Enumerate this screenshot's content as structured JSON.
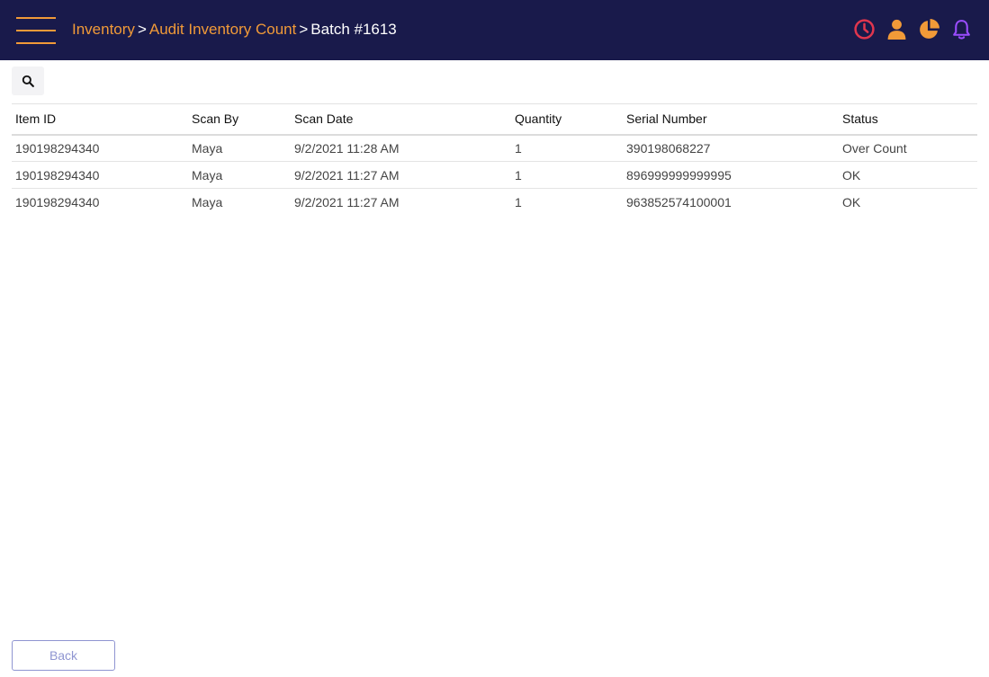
{
  "breadcrumb": {
    "items": [
      "Inventory",
      "Audit Inventory Count"
    ],
    "separator": ">",
    "current": "Batch #1613"
  },
  "icons": {
    "menu": "hamburger-menu-icon",
    "history": "clock-icon",
    "user": "user-icon",
    "reports": "pie-chart-icon",
    "notifications": "bell-icon",
    "search": "search-icon"
  },
  "colors": {
    "topbar": "#191a4b",
    "accent_orange": "#f19a38",
    "clock_red": "#e0364e",
    "bell_purple": "#9b4dff",
    "back_button": "#8f95d1"
  },
  "table": {
    "columns": [
      "Item ID",
      "Scan By",
      "Scan Date",
      "Quantity",
      "Serial Number",
      "Status"
    ],
    "rows": [
      [
        "190198294340",
        "Maya",
        "9/2/2021 11:28 AM",
        "1",
        "390198068227",
        "Over Count"
      ],
      [
        "190198294340",
        "Maya",
        "9/2/2021 11:27 AM",
        "1",
        "896999999999995",
        "OK"
      ],
      [
        "190198294340",
        "Maya",
        "9/2/2021 11:27 AM",
        "1",
        "963852574100001",
        "OK"
      ]
    ]
  },
  "footer": {
    "back_label": "Back"
  }
}
